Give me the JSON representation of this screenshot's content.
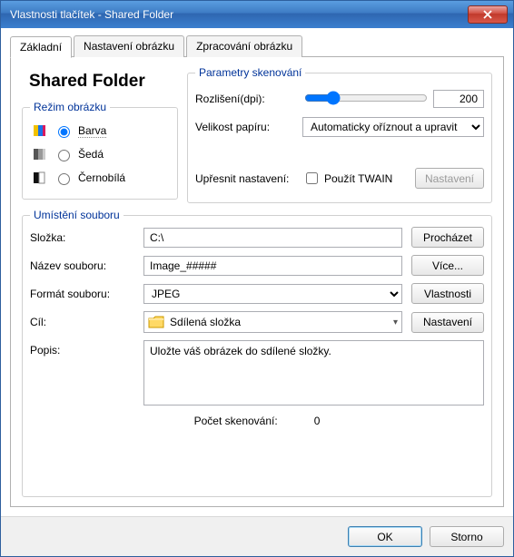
{
  "window": {
    "title": "Vlastnosti tlačítek - Shared Folder"
  },
  "tabs": {
    "basic": "Základní",
    "image_settings": "Nastavení obrázku",
    "image_processing": "Zpracování obrázku"
  },
  "heading": "Shared Folder",
  "image_mode": {
    "legend": "Režim obrázku",
    "color": "Barva",
    "gray": "Šedá",
    "bw": "Černobílá",
    "selected": "color"
  },
  "scan_params": {
    "legend": "Parametry skenování",
    "resolution_label": "Rozlišení(dpi):",
    "resolution_value": "200",
    "paper_label": "Velikost papíru:",
    "paper_value": "Automaticky oříznout a upravit",
    "advanced_label": "Upřesnit nastavení:",
    "twain_label": "Použít TWAIN",
    "settings_btn": "Nastavení"
  },
  "file_location": {
    "legend": "Umístění souboru",
    "folder_label": "Složka:",
    "folder_value": "C:\\",
    "browse_btn": "Procházet",
    "filename_label": "Název souboru:",
    "filename_value": "Image_#####",
    "more_btn": "Více...",
    "format_label": "Formát souboru:",
    "format_value": "JPEG",
    "properties_btn": "Vlastnosti",
    "dest_label": "Cíl:",
    "dest_value": "Sdílená složka",
    "dest_settings_btn": "Nastavení",
    "desc_label": "Popis:",
    "desc_value": "Uložte váš obrázek do sdílené složky."
  },
  "scan_count": {
    "label": "Počet skenování:",
    "value": "0"
  },
  "footer": {
    "ok": "OK",
    "cancel": "Storno"
  }
}
